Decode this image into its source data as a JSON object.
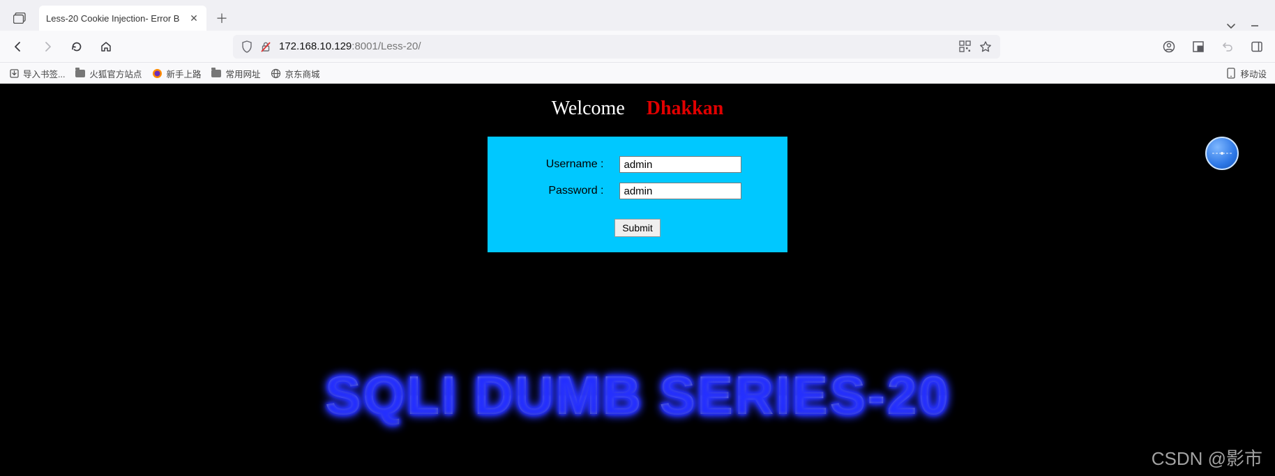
{
  "browser": {
    "tab_title": "Less-20 Cookie Injection- Error B",
    "url_host": "172.168.10.129",
    "url_port": ":8001",
    "url_path": "/Less-20/"
  },
  "bookmarks": {
    "import_label": "导入书签...",
    "items": [
      {
        "label": "火狐官方站点",
        "icon": "folder"
      },
      {
        "label": "新手上路",
        "icon": "firefox"
      },
      {
        "label": "常用网址",
        "icon": "folder"
      },
      {
        "label": "京东商城",
        "icon": "globe"
      }
    ],
    "mobile_label": "移动设"
  },
  "page": {
    "welcome_label": "Welcome",
    "welcome_name": "Dhakkan",
    "form": {
      "username_label": "Username :",
      "username_value": "admin",
      "password_label": "Password :",
      "password_value": "admin",
      "submit_label": "Submit"
    },
    "banner_text": "SQLI DUMB SERIES-20",
    "watermark": "CSDN @影市"
  }
}
